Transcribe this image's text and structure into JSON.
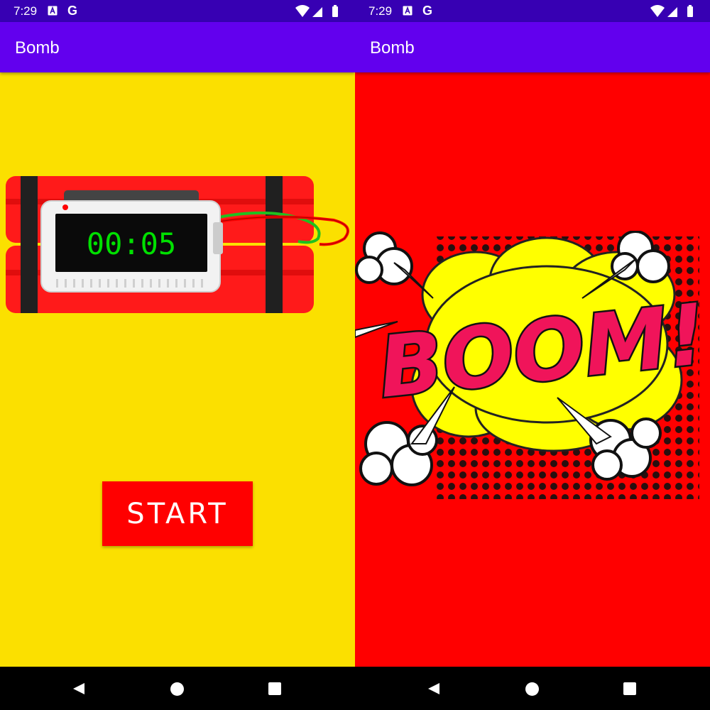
{
  "status_bar": {
    "time": "7:29",
    "g_label": "G"
  },
  "app": {
    "title": "Bomb"
  },
  "bomb": {
    "timer": "00:05"
  },
  "start_button": {
    "label": "START"
  },
  "explosion": {
    "text": "BOOM!"
  },
  "colors": {
    "status_bar": "#3700b3",
    "app_bar": "#6200ee",
    "ready_background": "#fbe000",
    "exploded_background": "#ff0000",
    "dynamite_red": "#ff1a1a",
    "timer_digits": "#00e000",
    "boom_text": "#f0145a",
    "explosion_cloud": "#ffff00"
  },
  "icons": [
    "a-notification-icon",
    "google-icon",
    "wifi-icon",
    "signal-icon",
    "battery-icon",
    "back-icon",
    "home-icon",
    "recents-icon"
  ]
}
